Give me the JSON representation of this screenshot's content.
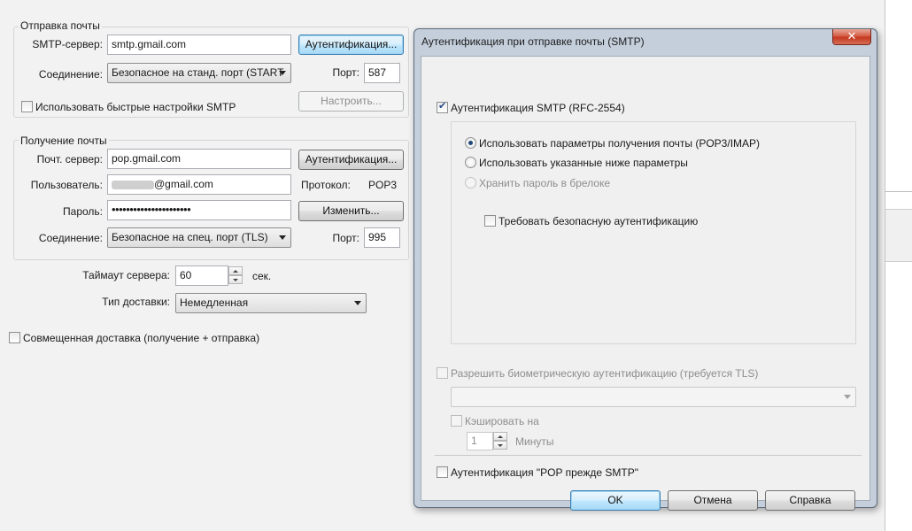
{
  "main": {
    "send_group": {
      "title": "Отправка почты",
      "smtp_server_label": "SMTP-сервер:",
      "smtp_server_value": "smtp.gmail.com",
      "auth_button": "Аутентификация...",
      "connection_label": "Соединение:",
      "connection_value": "Безопасное на станд. порт (START",
      "port_label": "Порт:",
      "port_value": "587",
      "quick_settings_label": "Использовать быстрые настройки SMTP",
      "configure_button": "Настроить..."
    },
    "receive_group": {
      "title": "Получение почты",
      "mail_server_label": "Почт. сервер:",
      "mail_server_value": "pop.gmail.com",
      "auth_button": "Аутентификация...",
      "user_label": "Пользователь:",
      "user_value": "@gmail.com",
      "protocol_label": "Протокол:",
      "protocol_value": "POP3",
      "password_label": "Пароль:",
      "password_value": "••••••••••••••••••••••",
      "change_button": "Изменить...",
      "connection_label": "Соединение:",
      "connection_value": "Безопасное на спец. порт (TLS)",
      "port_label": "Порт:",
      "port_value": "995"
    },
    "timeout_label": "Таймаут сервера:",
    "timeout_value": "60",
    "timeout_unit": "сек.",
    "delivery_label": "Тип доставки:",
    "delivery_value": "Немедленная",
    "combined_delivery_label": "Совмещенная доставка (получение + отправка)"
  },
  "dialog": {
    "title": "Аутентификация при отправке почты (SMTP)",
    "close_glyph": "✕",
    "smtp_auth_label": "Аутентификация SMTP (RFC-2554)",
    "smtp_auth_checked": true,
    "radio_use_receive": "Использовать параметры получения почты (POP3/IMAP)",
    "radio_use_below": "Использовать указанные ниже параметры",
    "radio_keychain": "Хранить пароль в брелоке",
    "secure_auth_label": "Требовать безопасную аутентификацию",
    "biometric_label": "Разрешить биометрическую аутентификацию (требуется TLS)",
    "cache_label": "Кэшировать на",
    "cache_value": "1",
    "cache_unit": "Минуты",
    "pop_before_smtp_label": "Аутентификация \"POP прежде SMTP\"",
    "ok_button": "OK",
    "cancel_button": "Отмена",
    "help_button": "Справка"
  }
}
